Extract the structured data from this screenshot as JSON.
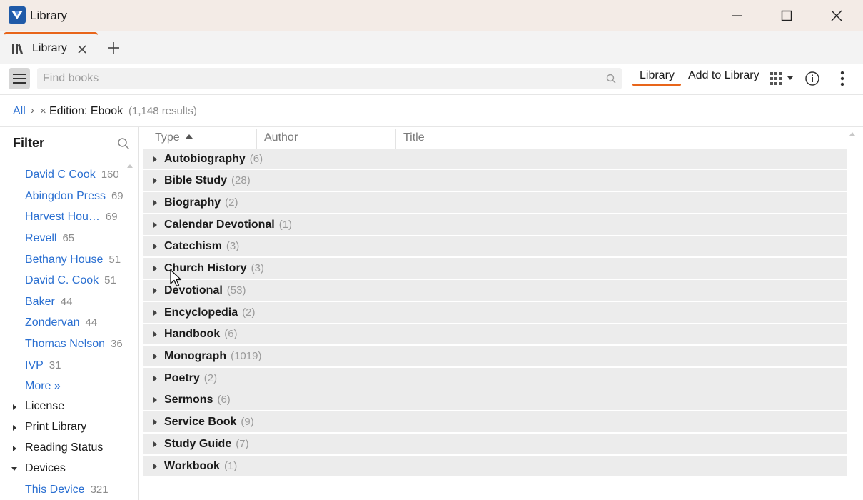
{
  "window": {
    "title": "Library",
    "accent": "#e8651a",
    "logo_color": "#1f5aa8",
    "controls": [
      "minimize-icon",
      "maximize-icon",
      "close-icon"
    ]
  },
  "tabs": [
    {
      "label": "Library",
      "icon": "library-books-icon",
      "active": true
    }
  ],
  "new_tab_icon": "plus-icon",
  "toolbar": {
    "menu_icon": "hamburger-icon",
    "search_placeholder": "Find books",
    "search_value": "",
    "library_label": "Library",
    "add_label": "Add to Library",
    "view_icon": "grid-view-icon",
    "info_icon": "info-icon",
    "more_icon": "more-vertical-icon"
  },
  "breadcrumb": {
    "all": "All",
    "separator": "›",
    "remove": "×",
    "filter": "Edition: Ebook",
    "results": "(1,148 results)"
  },
  "sidebar": {
    "title": "Filter",
    "publishers": [
      {
        "name": "David C Cook",
        "count": "160"
      },
      {
        "name": "Abingdon Press",
        "count": "69"
      },
      {
        "name": "Harvest Hou…",
        "count": "69"
      },
      {
        "name": "Revell",
        "count": "65"
      },
      {
        "name": "Bethany House",
        "count": "51"
      },
      {
        "name": "David C. Cook",
        "count": "51"
      },
      {
        "name": "Baker",
        "count": "44"
      },
      {
        "name": "Zondervan",
        "count": "44"
      },
      {
        "name": "Thomas Nelson",
        "count": "36"
      },
      {
        "name": "IVP",
        "count": "31"
      }
    ],
    "more": "More »",
    "facets": [
      {
        "label": "License",
        "expanded": false
      },
      {
        "label": "Print Library",
        "expanded": false
      },
      {
        "label": "Reading Status",
        "expanded": false
      },
      {
        "label": "Devices",
        "expanded": true
      }
    ],
    "device_items": [
      {
        "name": "This Device",
        "count": "321"
      }
    ]
  },
  "columns": {
    "type": "Type",
    "author": "Author",
    "title": "Title",
    "sort": "ascending"
  },
  "types": [
    {
      "label": "Autobiography",
      "count": "(6)"
    },
    {
      "label": "Bible Study",
      "count": "(28)"
    },
    {
      "label": "Biography",
      "count": "(2)"
    },
    {
      "label": "Calendar Devotional",
      "count": "(1)"
    },
    {
      "label": "Catechism",
      "count": "(3)"
    },
    {
      "label": "Church History",
      "count": "(3)"
    },
    {
      "label": "Devotional",
      "count": "(53)"
    },
    {
      "label": "Encyclopedia",
      "count": "(2)"
    },
    {
      "label": "Handbook",
      "count": "(6)"
    },
    {
      "label": "Monograph",
      "count": "(1019)"
    },
    {
      "label": "Poetry",
      "count": "(2)"
    },
    {
      "label": "Sermons",
      "count": "(6)"
    },
    {
      "label": "Service Book",
      "count": "(9)"
    },
    {
      "label": "Study Guide",
      "count": "(7)"
    },
    {
      "label": "Workbook",
      "count": "(1)"
    }
  ]
}
